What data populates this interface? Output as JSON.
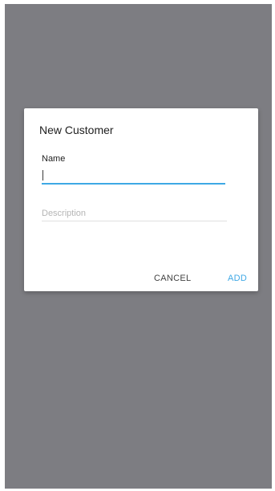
{
  "dialog": {
    "title": "New Customer",
    "name_label": "Name",
    "name_value": "",
    "description_placeholder": "Description",
    "description_value": "",
    "cancel_label": "CANCEL",
    "add_label": "ADD"
  },
  "colors": {
    "accent": "#3ea8e5",
    "scrim": "#7d7d84",
    "dialog_background": "#ffffff"
  }
}
